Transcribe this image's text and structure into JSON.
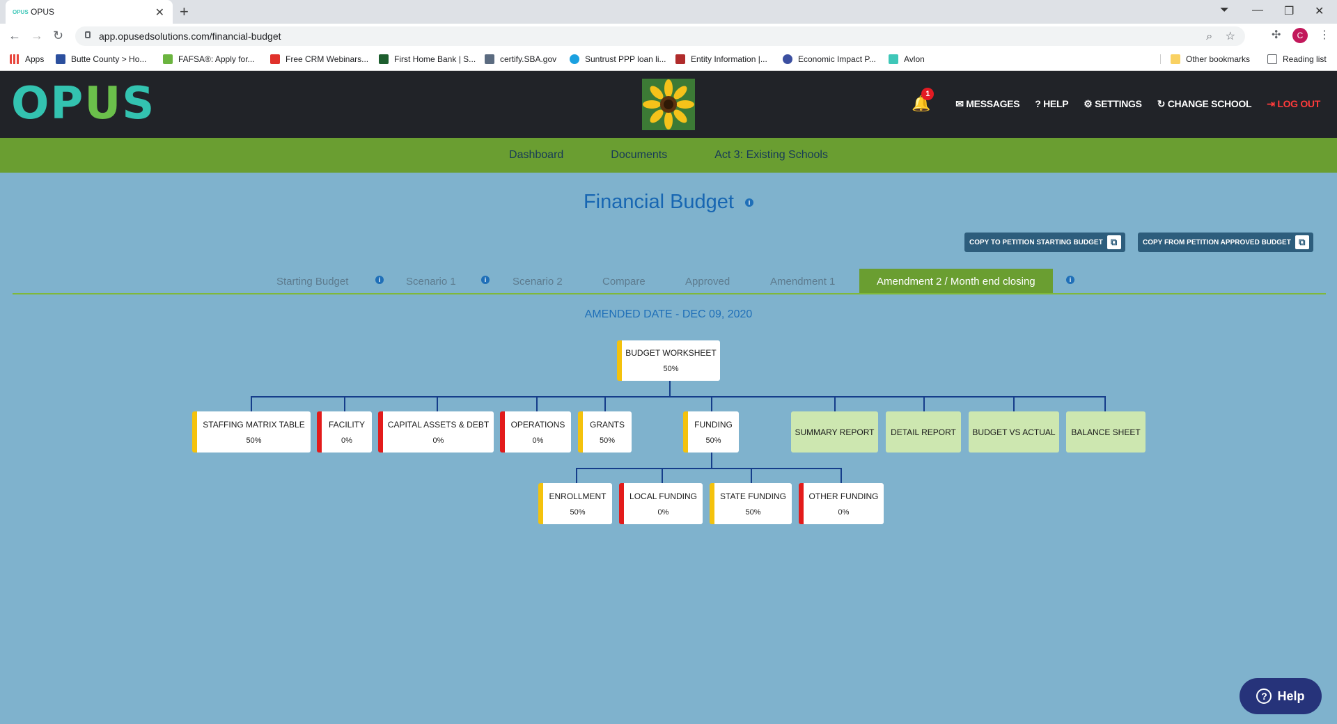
{
  "browser": {
    "tab_title": "OPUS",
    "tab_favicon": "OPUS",
    "url": "app.opusedsolutions.com/financial-budget",
    "avatar_letter": "C",
    "bookmarks": [
      {
        "label": "Apps",
        "color": "#e8453c"
      },
      {
        "label": "Butte County > Ho...",
        "color": "#2b4f9e"
      },
      {
        "label": "FAFSA®: Apply for...",
        "color": "#6bb43f"
      },
      {
        "label": "Free CRM Webinars...",
        "color": "#e0312b"
      },
      {
        "label": "First Home Bank | S...",
        "color": "#1d5e2e"
      },
      {
        "label": "certify.SBA.gov",
        "color": "#5b6b80"
      },
      {
        "label": "Suntrust PPP loan li...",
        "color": "#1aa0e0"
      },
      {
        "label": "Entity Information |...",
        "color": "#b02b2b"
      },
      {
        "label": "Economic Impact P...",
        "color": "#3b4fa0"
      },
      {
        "label": "Avlon",
        "color": "#3ec7b8"
      }
    ],
    "other_bookmarks": "Other bookmarks",
    "reading_list": "Reading list"
  },
  "header": {
    "logo": "OPUS",
    "notification_count": "1",
    "nav": {
      "messages": "MESSAGES",
      "help": "HELP",
      "settings": "SETTINGS",
      "change_school": "CHANGE SCHOOL",
      "logout": "LOG OUT"
    }
  },
  "main_nav": {
    "dashboard": "Dashboard",
    "documents": "Documents",
    "act3": "Act 3: Existing Schools"
  },
  "page": {
    "title": "Financial Budget",
    "copy_to_petition": "COPY TO PETITION STARTING BUDGET",
    "copy_from_petition": "COPY FROM PETITION APPROVED BUDGET",
    "tabs": {
      "starting": "Starting Budget",
      "scenario1": "Scenario 1",
      "scenario2": "Scenario 2",
      "compare": "Compare",
      "approved": "Approved",
      "amendment1": "Amendment 1",
      "amendment2": "Amendment 2 / Month end closing"
    },
    "amended_date": "AMENDED DATE - DEC 09, 2020"
  },
  "chart": {
    "root": {
      "label": "BUDGET WORKSHEET",
      "pct": "50%",
      "status_color": "#f4c20d"
    },
    "level1": {
      "staffing": {
        "label": "STAFFING MATRIX TABLE",
        "pct": "50%",
        "status_color": "#f4c20d"
      },
      "facility": {
        "label": "FACILITY",
        "pct": "0%",
        "status_color": "#e31b1b"
      },
      "capital": {
        "label": "CAPITAL ASSETS & DEBT",
        "pct": "0%",
        "status_color": "#e31b1b"
      },
      "operations": {
        "label": "OPERATIONS",
        "pct": "0%",
        "status_color": "#e31b1b"
      },
      "grants": {
        "label": "GRANTS",
        "pct": "50%",
        "status_color": "#f4c20d"
      },
      "funding": {
        "label": "FUNDING",
        "pct": "50%",
        "status_color": "#f4c20d"
      },
      "summary": {
        "label": "SUMMARY REPORT"
      },
      "detail": {
        "label": "DETAIL REPORT"
      },
      "bva": {
        "label": "BUDGET VS ACTUAL"
      },
      "balance": {
        "label": "BALANCE SHEET"
      }
    },
    "level2": {
      "enrollment": {
        "label": "ENROLLMENT",
        "pct": "50%",
        "status_color": "#f4c20d"
      },
      "local": {
        "label": "LOCAL FUNDING",
        "pct": "0%",
        "status_color": "#e31b1b"
      },
      "state": {
        "label": "STATE FUNDING",
        "pct": "50%",
        "status_color": "#f4c20d"
      },
      "other": {
        "label": "OTHER FUNDING",
        "pct": "0%",
        "status_color": "#e31b1b"
      }
    }
  },
  "help_button": "Help",
  "colors": {
    "page_bg": "#7fb2cd",
    "header_bg": "#212328",
    "nav_green": "#6a9e31",
    "title_blue": "#1766b2",
    "status_yellow": "#f4c20d",
    "status_red": "#e31b1b",
    "report_green": "#cde7b0"
  }
}
